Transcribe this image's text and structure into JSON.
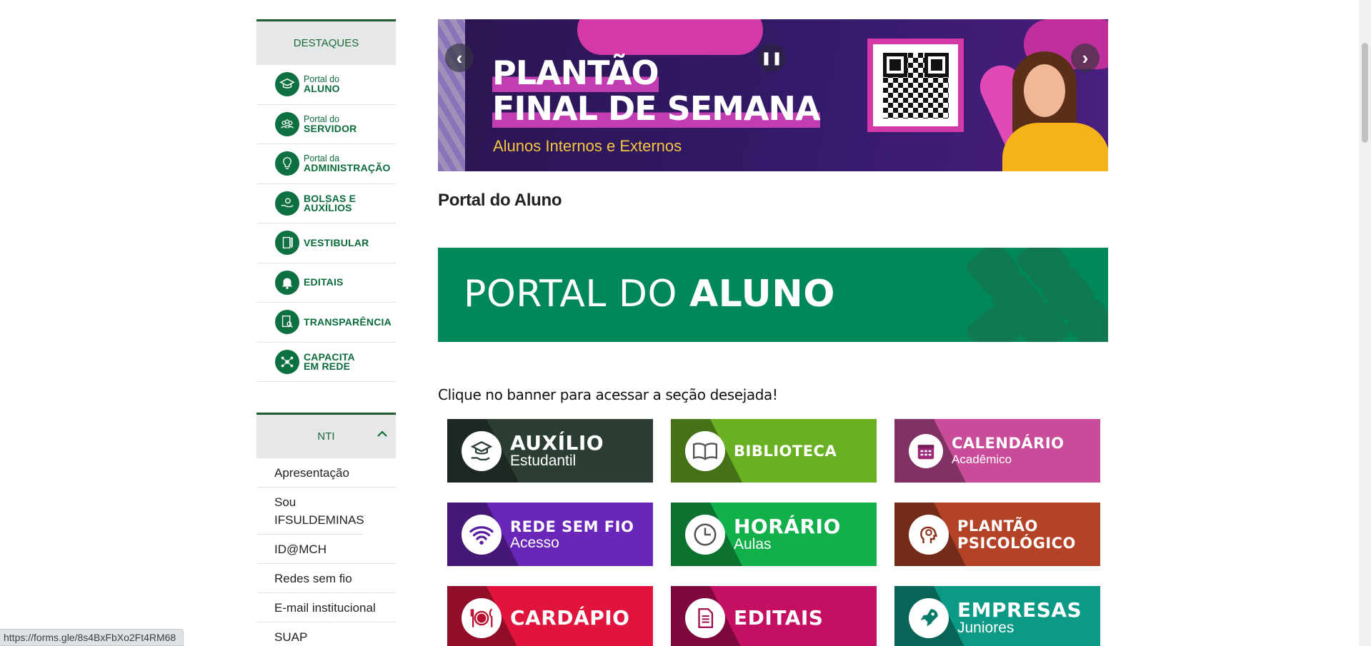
{
  "sidebar": {
    "destaques_title": "DESTAQUES",
    "destaques": [
      {
        "small": "Portal do",
        "big": "ALUNO",
        "icon": "graduation-cap-icon"
      },
      {
        "small": "Portal do",
        "big": "SERVIDOR",
        "icon": "people-icon"
      },
      {
        "small": "Portal da",
        "big": "ADMINISTRAÇÃO",
        "icon": "lightbulb-icon"
      },
      {
        "big": "BOLSAS E",
        "big2": "AUXÍLIOS",
        "icon": "hand-coin-icon"
      },
      {
        "big": "VESTIBULAR",
        "icon": "book-pencil-icon"
      },
      {
        "big": "EDITAIS",
        "icon": "bell-icon"
      },
      {
        "big": "TRANSPARÊNCIA",
        "icon": "document-search-icon"
      },
      {
        "big": "CAPACITA",
        "big2": "EM REDE",
        "icon": "network-icon"
      }
    ],
    "nti_title": "NTI",
    "nti_items": [
      "Apresentação",
      "Sou IFSULDEMINAS",
      "ID@MCH",
      "Redes sem fio",
      "E-mail institucional",
      "SUAP"
    ]
  },
  "carousel": {
    "title_line1": "PLANTÃO",
    "title_line2": "FINAL DE SEMANA",
    "subtitle": "Alunos Internos e Externos"
  },
  "main": {
    "page_title": "Portal do Aluno",
    "banner_regular": "PORTAL DO ",
    "banner_bold": "ALUNO",
    "instruction": "Clique no banner para acessar a seção desejada!"
  },
  "tiles": [
    {
      "main": "AUXÍLIO",
      "sub": "Estudantil",
      "color": "#2c3e34",
      "icon": "graduation-hand-icon"
    },
    {
      "main": "BIBLIOTECA",
      "sub": "",
      "color": "#6ab023",
      "icon": "open-book-icon"
    },
    {
      "main": "CALENDÁRIO",
      "sub": "Acadêmico",
      "color": "#c84c9a",
      "icon": "calendar-icon"
    },
    {
      "main": "REDE SEM FIO",
      "sub": "Acesso",
      "color": "#6a26b8",
      "icon": "wifi-icon"
    },
    {
      "main": "HORÁRIO",
      "sub": "Aulas",
      "color": "#12b04a",
      "icon": "clock-icon"
    },
    {
      "main": "PLANTÃO",
      "sub": "PSICOLÓGICO",
      "color": "#b34226",
      "icon": "head-icon"
    },
    {
      "main": "CARDÁPIO",
      "sub": "",
      "color": "#e0143c",
      "icon": "plate-cutlery-icon"
    },
    {
      "main": "EDITAIS",
      "sub": "",
      "color": "#c40f62",
      "icon": "document-icon"
    },
    {
      "main": "EMPRESAS",
      "sub": "Juniores",
      "color": "#0c9a86",
      "icon": "rocket-icon"
    }
  ],
  "status_bar": {
    "url": "https://forms.gle/8s4BxFbXo2Ft4RM68"
  }
}
